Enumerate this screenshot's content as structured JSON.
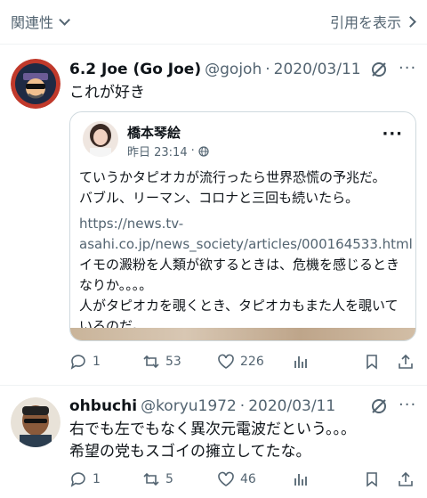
{
  "header": {
    "sort_label": "関連性",
    "quotes_label": "引用を表示"
  },
  "tweets": [
    {
      "name": "6.2 Joe (Go Joe)",
      "handle": "@gojoh",
      "separator": "·",
      "date": "2020/03/11",
      "text": "これが好き",
      "quote": {
        "name": "橋本琴絵",
        "time": "昨日 23:14",
        "separator": "·",
        "body_lines": [
          "ていうかタピオカが流行ったら世界恐慌の予兆だ。",
          "バブル、リーマン、コロナと三回も続いたら。"
        ],
        "link_line1": "https://news.tv-",
        "link_line2": "asahi.co.jp/news_society/articles/000164533.html",
        "body_lines2": [
          "イモの澱粉を人類が欲するときは、危機を感じるとき",
          "なりか。。。。",
          "人がタピオカを覗くとき、タピオカもまた人を覗いて",
          "いるのだ。"
        ]
      },
      "actions": {
        "replies": "1",
        "retweets": "53",
        "likes": "226"
      }
    },
    {
      "name": "ohbuchi",
      "handle": "@koryu1972",
      "separator": "·",
      "date": "2020/03/11",
      "text_line1": "右でも左でもなく異次元電波だという。。。",
      "text_line2": "希望の党もスゴイの擁立してたな。",
      "actions": {
        "replies": "1",
        "retweets": "5",
        "likes": "46"
      }
    }
  ],
  "icons": [
    "reply-icon",
    "retweet-icon",
    "like-icon",
    "views-icon",
    "bookmark-icon",
    "share-icon",
    "grok-icon",
    "more-icon",
    "globe-icon"
  ],
  "colors": {
    "text": "#0f1419",
    "secondary": "#536471",
    "border": "#cfd9de",
    "divider": "#eff3f4"
  }
}
